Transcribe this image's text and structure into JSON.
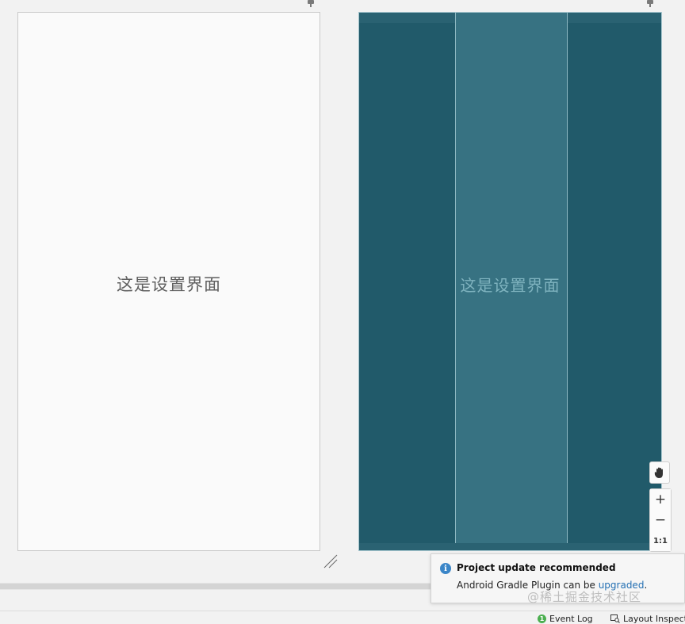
{
  "design_view": {
    "label": "这是设置界面"
  },
  "blueprint_view": {
    "label": "这是设置界面"
  },
  "zoom_controls": {
    "pan_icon": "hand-icon",
    "zoom_in": "+",
    "zoom_out": "−",
    "fit": "1:1"
  },
  "notification": {
    "icon": "info-icon",
    "title": "Project update recommended",
    "body_prefix": "Android Gradle Plugin can be ",
    "link": "upgraded",
    "body_suffix": "."
  },
  "status_bar": {
    "event_log_count": "1",
    "event_log": "Event Log",
    "layout_inspector": "Layout Inspect"
  },
  "watermark": "@稀土掘金技术社区",
  "colors": {
    "blueprint_bg": "#215a6a",
    "blueprint_column": "#377282",
    "design_bg": "#fafafa",
    "link": "#2470b3",
    "info": "#3b86c8"
  }
}
